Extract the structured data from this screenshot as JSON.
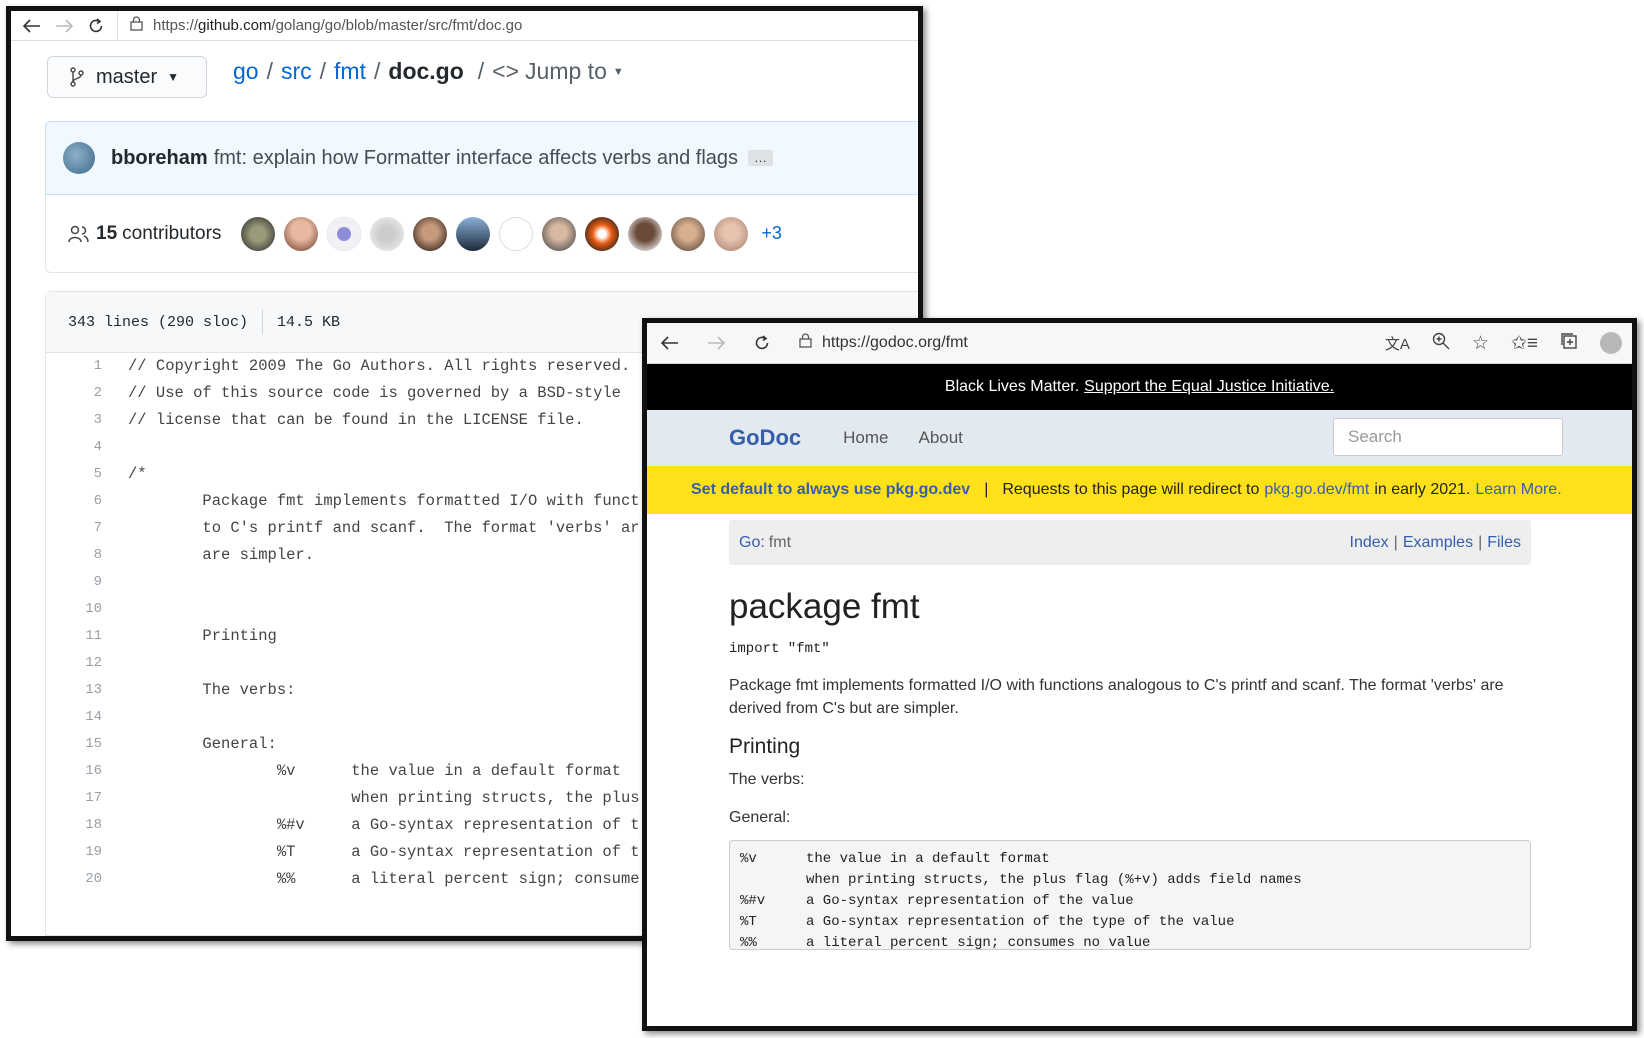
{
  "github_window": {
    "url_prefix": "https://",
    "url_host": "github.com",
    "url_path": "/golang/go/blob/master/src/fmt/doc.go",
    "branch": "master",
    "breadcrumb": {
      "p1": "go",
      "p2": "src",
      "p3": "fmt",
      "file": "doc.go",
      "jump": "Jump to"
    },
    "commit": {
      "author": "bboreham",
      "message": "fmt: explain how Formatter interface affects verbs and flags",
      "more": "…"
    },
    "contributors": {
      "count": "15",
      "label": "contributors",
      "extra": "+3"
    },
    "file_info": {
      "lines": "343 lines (290 sloc)",
      "size": "14.5 KB"
    },
    "code_lines": [
      {
        "n": "1",
        "t": "// Copyright 2009 The Go Authors. All rights reserved."
      },
      {
        "n": "2",
        "t": "// Use of this source code is governed by a BSD-style"
      },
      {
        "n": "3",
        "t": "// license that can be found in the LICENSE file."
      },
      {
        "n": "4",
        "t": ""
      },
      {
        "n": "5",
        "t": "/*"
      },
      {
        "n": "6",
        "t": "        Package fmt implements formatted I/O with funct"
      },
      {
        "n": "7",
        "t": "        to C's printf and scanf.  The format 'verbs' ar"
      },
      {
        "n": "8",
        "t": "        are simpler."
      },
      {
        "n": "9",
        "t": ""
      },
      {
        "n": "10",
        "t": ""
      },
      {
        "n": "11",
        "t": "        Printing"
      },
      {
        "n": "12",
        "t": ""
      },
      {
        "n": "13",
        "t": "        The verbs:"
      },
      {
        "n": "14",
        "t": ""
      },
      {
        "n": "15",
        "t": "        General:"
      },
      {
        "n": "16",
        "t": "                %v      the value in a default format"
      },
      {
        "n": "17",
        "t": "                        when printing structs, the plus"
      },
      {
        "n": "18",
        "t": "                %#v     a Go-syntax representation of t"
      },
      {
        "n": "19",
        "t": "                %T      a Go-syntax representation of t"
      },
      {
        "n": "20",
        "t": "                %%      a literal percent sign; consume"
      }
    ]
  },
  "godoc_window": {
    "url": "https://godoc.org/fmt",
    "banner_text": "Black Lives Matter.",
    "banner_link": "Support the Equal Justice Initiative.",
    "nav": {
      "brand": "GoDoc",
      "home": "Home",
      "about": "About",
      "search_placeholder": "Search"
    },
    "notice": {
      "set_default": "Set default to always use pkg.go.dev",
      "sep": "|",
      "text1": "Requests to this page will redirect to",
      "link": "pkg.go.dev/fmt",
      "text2": "in early 2021.",
      "learn": "Learn More."
    },
    "crumb": {
      "go": "Go:",
      "pkg": "fmt",
      "index": "Index",
      "examples": "Examples",
      "files": "Files",
      "sep": "|"
    },
    "title": "package fmt",
    "import": "import \"fmt\"",
    "description": "Package fmt implements formatted I/O with functions analogous to C's printf and scanf. The format 'verbs' are derived from C's but are simpler.",
    "printing": "Printing",
    "verbs_label": "The verbs:",
    "general_label": "General:",
    "verbs": [
      {
        "v": "%v",
        "d": "the value in a default format"
      },
      {
        "v": "",
        "d": "when printing structs, the plus flag (%+v) adds field names"
      },
      {
        "v": "%#v",
        "d": "a Go-syntax representation of the value"
      },
      {
        "v": "%T",
        "d": "a Go-syntax representation of the type of the value"
      },
      {
        "v": "%%",
        "d": "a literal percent sign; consumes no value"
      }
    ]
  }
}
